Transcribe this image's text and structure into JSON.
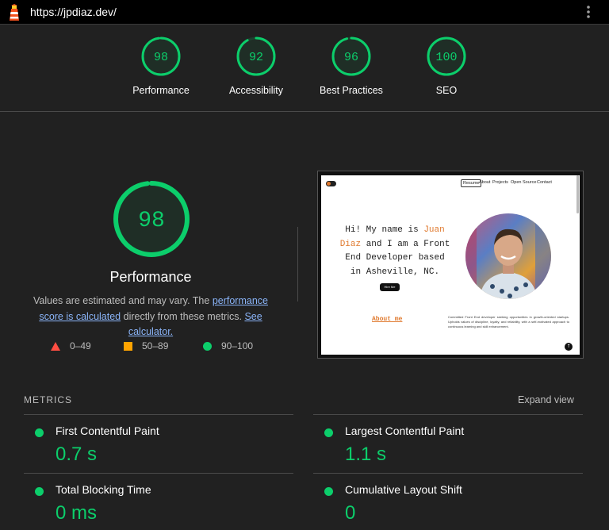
{
  "header": {
    "url": "https://jpdiaz.dev/",
    "logo_icon": "lighthouse-icon",
    "menu_icon": "kebab-menu-icon"
  },
  "scores": [
    {
      "value": "98",
      "label": "Performance",
      "fraction": 0.98
    },
    {
      "value": "92",
      "label": "Accessibility",
      "fraction": 0.92
    },
    {
      "value": "96",
      "label": "Best Practices",
      "fraction": 0.96
    },
    {
      "value": "100",
      "label": "SEO",
      "fraction": 1.0
    }
  ],
  "performance": {
    "score": "98",
    "fraction": 0.98,
    "title": "Performance",
    "desc_prefix": "Values are estimated and may vary. The ",
    "link_score": "performance score is calculated",
    "desc_middle": " directly from these metrics. ",
    "link_calculator": "See calculator."
  },
  "legend": [
    {
      "range": "0–49",
      "shape": "triangle",
      "color": "#ff4e42"
    },
    {
      "range": "50–89",
      "shape": "square",
      "color": "#ffa400"
    },
    {
      "range": "90–100",
      "shape": "circle",
      "color": "#0cce6b"
    }
  ],
  "screenshot": {
    "nav": [
      "Resume",
      "About",
      "Projects",
      "Open Source",
      "Contact"
    ],
    "hero_line1a": "Hi! My name is ",
    "hero_name1": "Juan",
    "hero_name2": "Diaz",
    "hero_line2b": " and I am a Front",
    "hero_line3": "End Developer based",
    "hero_line4": "in Asheville, NC.",
    "hire_button": "Hire Me",
    "about_link": "About me",
    "about_text": "Committed Front End developer seeking opportunities in growth-oriented startups. Upholds values of discipline, loyalty, and reliability, with a self-motivated approach to continuous learning and skill enhancement.",
    "scroll_top": "↑"
  },
  "metrics": {
    "heading": "METRICS",
    "expand_label": "Expand view",
    "items": [
      {
        "name": "First Contentful Paint",
        "value": "0.7 s"
      },
      {
        "name": "Largest Contentful Paint",
        "value": "1.1 s"
      },
      {
        "name": "Total Blocking Time",
        "value": "0 ms"
      },
      {
        "name": "Cumulative Layout Shift",
        "value": "0"
      }
    ]
  },
  "colors": {
    "pass": "#0cce6b",
    "average": "#ffa400",
    "fail": "#ff4e42",
    "link": "#8ab4f8",
    "accent_site": "#e07a2f"
  }
}
